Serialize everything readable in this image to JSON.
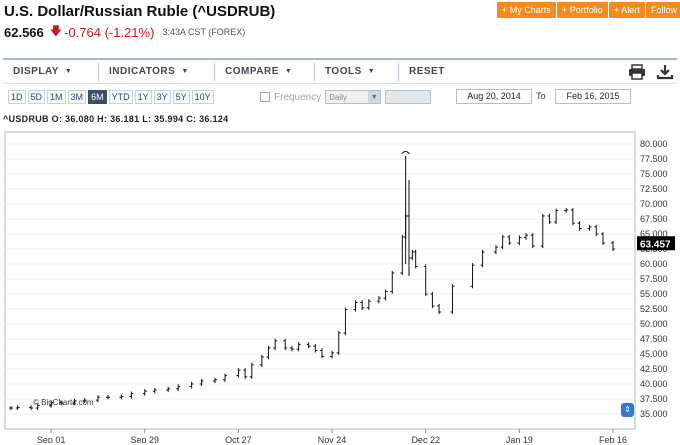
{
  "header": {
    "title": "U.S. Dollar/Russian Ruble (^USDRUB)",
    "price": "62.566",
    "change": "-0.764 (-1.21%)",
    "time": "3:43A CST (FOREX)"
  },
  "actions": {
    "my_charts": "+ My Charts",
    "portfolio": "+ Portfolio",
    "alert": "+ Alert",
    "follow": "Follow"
  },
  "toolbar": {
    "display": "DISPLAY",
    "indicators": "INDICATORS",
    "compare": "COMPARE",
    "tools": "TOOLS",
    "reset": "RESET",
    "print_icon": "printer-icon",
    "download_icon": "download-icon"
  },
  "ranges": [
    "1D",
    "5D",
    "1M",
    "3M",
    "6M",
    "YTD",
    "1Y",
    "3Y",
    "5Y",
    "10Y"
  ],
  "active_range": "6M",
  "frequency": {
    "label": "Frequency",
    "value": "Daily"
  },
  "dates": {
    "from": "Aug 20, 2014",
    "to_label": "To",
    "to": "Feb 16, 2015"
  },
  "ohlc": "^USDRUB O: 36.080  H: 36.181  L: 35.994  C: 36.124",
  "watermark": "© BigCharts.com",
  "colors": {
    "accent_orange": "#f48a1d",
    "negative_red": "#c41a1a",
    "last_price_bg": "#000000",
    "scroll_blue": "#2f7bd1"
  },
  "chart_data": {
    "type": "ohlc",
    "symbol": "^USDRUB",
    "x_ticks": [
      "Sep 01",
      "Sep 29",
      "Oct 27",
      "Nov 24",
      "Dec 22",
      "Jan 19",
      "Feb 16"
    ],
    "y_ticks": [
      "35.000",
      "37.500",
      "40.000",
      "42.500",
      "45.000",
      "47.500",
      "50.000",
      "52.500",
      "55.000",
      "57.500",
      "60.000",
      "62.500",
      "65.000",
      "67.500",
      "70.000",
      "72.500",
      "75.000",
      "77.500",
      "80.000"
    ],
    "ylim": [
      33.5,
      81.0
    ],
    "last_price": "63.457",
    "grid": true,
    "points": [
      [
        "Aug 20",
        36.0
      ],
      [
        "Aug 22",
        36.1
      ],
      [
        "Aug 26",
        36.0
      ],
      [
        "Aug 28",
        36.4
      ],
      [
        "Sep 01",
        36.9
      ],
      [
        "Sep 04",
        36.8
      ],
      [
        "Sep 08",
        37.2
      ],
      [
        "Sep 11",
        37.3
      ],
      [
        "Sep 15",
        37.8
      ],
      [
        "Sep 18",
        37.8
      ],
      [
        "Sep 22",
        37.9
      ],
      [
        "Sep 25",
        38.4
      ],
      [
        "Sep 29",
        38.8
      ],
      [
        "Oct 02",
        39.0
      ],
      [
        "Oct 06",
        39.2
      ],
      [
        "Oct 09",
        39.6
      ],
      [
        "Oct 13",
        40.0
      ],
      [
        "Oct 16",
        40.5
      ],
      [
        "Oct 20",
        40.7
      ],
      [
        "Oct 23",
        41.4
      ],
      [
        "Oct 27",
        42.3
      ],
      [
        "Oct 29",
        41.2
      ],
      [
        "Oct 31",
        43.2
      ],
      [
        "Nov 03",
        44.5
      ],
      [
        "Nov 05",
        46.0
      ],
      [
        "Nov 07",
        47.2
      ],
      [
        "Nov 10",
        46.0
      ],
      [
        "Nov 12",
        45.8
      ],
      [
        "Nov 14",
        46.6
      ],
      [
        "Nov 17",
        46.3
      ],
      [
        "Nov 19",
        45.6
      ],
      [
        "Nov 21",
        44.6
      ],
      [
        "Nov 24",
        45.2
      ],
      [
        "Nov 26",
        48.5
      ],
      [
        "Nov 28",
        52.4
      ],
      [
        "Dec 01",
        53.6
      ],
      [
        "Dec 03",
        52.7
      ],
      [
        "Dec 05",
        53.8
      ],
      [
        "Dec 08",
        54.3
      ],
      [
        "Dec 10",
        55.4
      ],
      [
        "Dec 12",
        58.5
      ],
      [
        "Dec 15",
        64.5
      ],
      [
        "Dec 16",
        68.0
      ],
      [
        "Dec 17",
        61.0
      ],
      [
        "Dec 18",
        62.0
      ],
      [
        "Dec 19",
        59.6
      ],
      [
        "Dec 22",
        55.0
      ],
      [
        "Dec 24",
        53.0
      ],
      [
        "Dec 26",
        52.0
      ],
      [
        "Dec 30",
        56.3
      ],
      [
        "Jan 05",
        59.8
      ],
      [
        "Jan 08",
        62.0
      ],
      [
        "Jan 12",
        62.8
      ],
      [
        "Jan 14",
        64.5
      ],
      [
        "Jan 16",
        63.5
      ],
      [
        "Jan 19",
        64.4
      ],
      [
        "Jan 21",
        64.8
      ],
      [
        "Jan 23",
        63.0
      ],
      [
        "Jan 26",
        68.0
      ],
      [
        "Jan 28",
        67.0
      ],
      [
        "Jan 30",
        68.9
      ],
      [
        "Feb 02",
        69.0
      ],
      [
        "Feb 04",
        66.8
      ],
      [
        "Feb 06",
        65.9
      ],
      [
        "Feb 09",
        66.2
      ],
      [
        "Feb 11",
        65.0
      ],
      [
        "Feb 13",
        63.5
      ],
      [
        "Feb 16",
        62.5
      ]
    ],
    "annotations": [
      {
        "date": "Dec 16",
        "high": 78.0,
        "low": 60.0
      },
      {
        "date": "Dec 17",
        "high": 74.0,
        "low": 58.0
      }
    ]
  }
}
